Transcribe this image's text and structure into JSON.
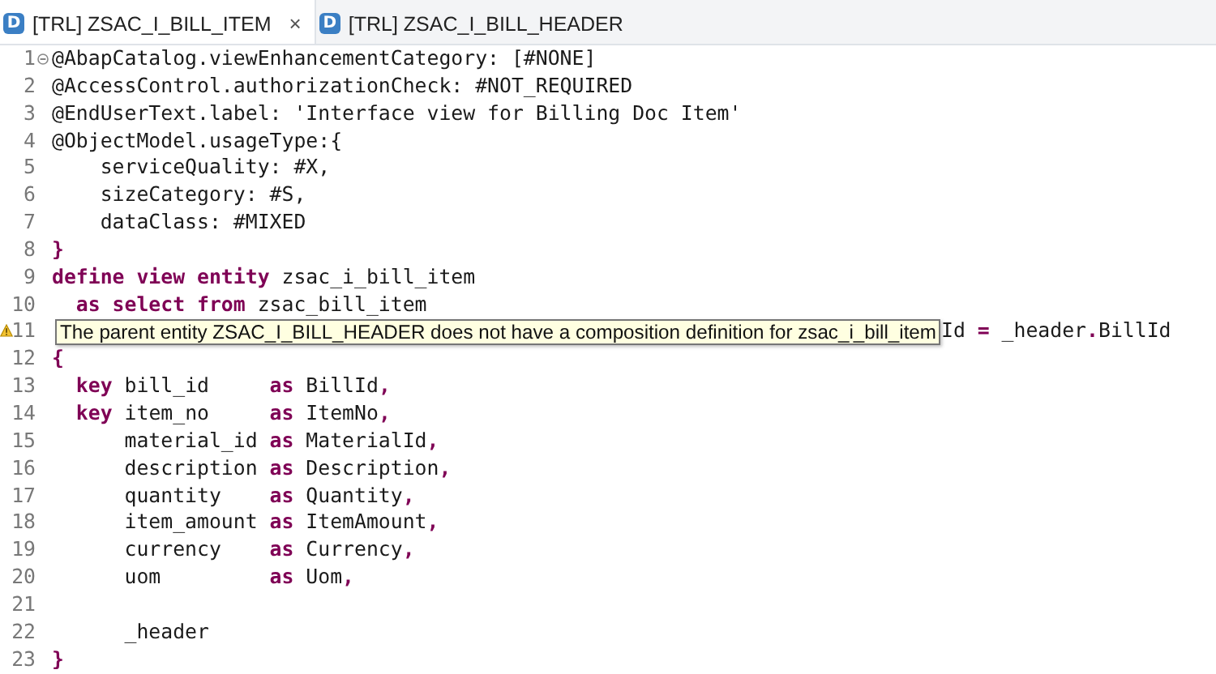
{
  "tabs": [
    {
      "icon_text": "D",
      "label": "[TRL] ZSAC_I_BILL_ITEM",
      "selected": true,
      "close": "×"
    },
    {
      "icon_text": "D",
      "label": "[TRL] ZSAC_I_BILL_HEADER",
      "selected": false
    }
  ],
  "editor": {
    "lines": [
      {
        "number": "1",
        "folding": true,
        "tokens": [
          {
            "kind": "plain",
            "text": "@AbapCatalog.viewEnhancementCategory: [#NONE]"
          }
        ]
      },
      {
        "number": "2",
        "tokens": [
          {
            "kind": "plain",
            "text": "@AccessControl.authorizationCheck: #NOT_REQUIRED"
          }
        ]
      },
      {
        "number": "3",
        "tokens": [
          {
            "kind": "plain",
            "text": "@EndUserText.label: 'Interface view for Billing Doc Item'"
          }
        ]
      },
      {
        "number": "4",
        "tokens": [
          {
            "kind": "plain",
            "text": "@ObjectModel.usageType:{"
          }
        ]
      },
      {
        "number": "5",
        "tokens": [
          {
            "kind": "plain",
            "text": "    serviceQuality: #X,"
          }
        ]
      },
      {
        "number": "6",
        "tokens": [
          {
            "kind": "plain",
            "text": "    sizeCategory: #S,"
          }
        ]
      },
      {
        "number": "7",
        "tokens": [
          {
            "kind": "plain",
            "text": "    dataClass: #MIXED"
          }
        ]
      },
      {
        "number": "8",
        "tokens": [
          {
            "kind": "operator",
            "text": "}"
          }
        ]
      },
      {
        "number": "9",
        "tokens": [
          {
            "kind": "keyword",
            "text": "define view entity"
          },
          {
            "kind": "plain",
            "text": " zsac_i_bill_item"
          }
        ]
      },
      {
        "number": "10",
        "tokens": [
          {
            "kind": "keyword",
            "text": "  as select from"
          },
          {
            "kind": "plain",
            "text": " zsac_bill_item"
          }
        ]
      },
      {
        "number": "11",
        "warning": true,
        "tooltip": "The parent entity ZSAC_I_BILL_HEADER does not have a composition definition for zsac_i_bill_item",
        "tokens": [
          {
            "kind": "plain",
            "text": "Id "
          },
          {
            "kind": "operator",
            "text": "="
          },
          {
            "kind": "plain",
            "text": " _header"
          },
          {
            "kind": "operator",
            "text": "."
          },
          {
            "kind": "plain",
            "text": "BillId"
          }
        ]
      },
      {
        "number": "12",
        "tokens": [
          {
            "kind": "operator",
            "text": "{"
          }
        ]
      },
      {
        "number": "13",
        "tokens": [
          {
            "kind": "keyword",
            "text": "  key"
          },
          {
            "kind": "plain",
            "text": " bill_id     "
          },
          {
            "kind": "keyword",
            "text": "as"
          },
          {
            "kind": "plain",
            "text": " BillId"
          },
          {
            "kind": "operator",
            "text": ","
          }
        ]
      },
      {
        "number": "14",
        "tokens": [
          {
            "kind": "keyword",
            "text": "  key"
          },
          {
            "kind": "plain",
            "text": " item_no     "
          },
          {
            "kind": "keyword",
            "text": "as"
          },
          {
            "kind": "plain",
            "text": " ItemNo"
          },
          {
            "kind": "operator",
            "text": ","
          }
        ]
      },
      {
        "number": "15",
        "tokens": [
          {
            "kind": "plain",
            "text": "      material_id "
          },
          {
            "kind": "keyword",
            "text": "as"
          },
          {
            "kind": "plain",
            "text": " MaterialId"
          },
          {
            "kind": "operator",
            "text": ","
          }
        ]
      },
      {
        "number": "16",
        "tokens": [
          {
            "kind": "plain",
            "text": "      description "
          },
          {
            "kind": "keyword",
            "text": "as"
          },
          {
            "kind": "plain",
            "text": " Description"
          },
          {
            "kind": "operator",
            "text": ","
          }
        ]
      },
      {
        "number": "17",
        "tokens": [
          {
            "kind": "plain",
            "text": "      quantity    "
          },
          {
            "kind": "keyword",
            "text": "as"
          },
          {
            "kind": "plain",
            "text": " Quantity"
          },
          {
            "kind": "operator",
            "text": ","
          }
        ]
      },
      {
        "number": "18",
        "tokens": [
          {
            "kind": "plain",
            "text": "      item_amount "
          },
          {
            "kind": "keyword",
            "text": "as"
          },
          {
            "kind": "plain",
            "text": " ItemAmount"
          },
          {
            "kind": "operator",
            "text": ","
          }
        ]
      },
      {
        "number": "19",
        "tokens": [
          {
            "kind": "plain",
            "text": "      currency    "
          },
          {
            "kind": "keyword",
            "text": "as"
          },
          {
            "kind": "plain",
            "text": " Currency"
          },
          {
            "kind": "operator",
            "text": ","
          }
        ]
      },
      {
        "number": "20",
        "tokens": [
          {
            "kind": "plain",
            "text": "      uom         "
          },
          {
            "kind": "keyword",
            "text": "as"
          },
          {
            "kind": "plain",
            "text": " Uom"
          },
          {
            "kind": "operator",
            "text": ","
          }
        ]
      },
      {
        "number": "21"
      },
      {
        "number": "22",
        "tokens": [
          {
            "kind": "plain",
            "text": "      _header"
          }
        ]
      },
      {
        "number": "23",
        "tokens": [
          {
            "kind": "operator",
            "text": "}"
          }
        ]
      }
    ]
  }
}
